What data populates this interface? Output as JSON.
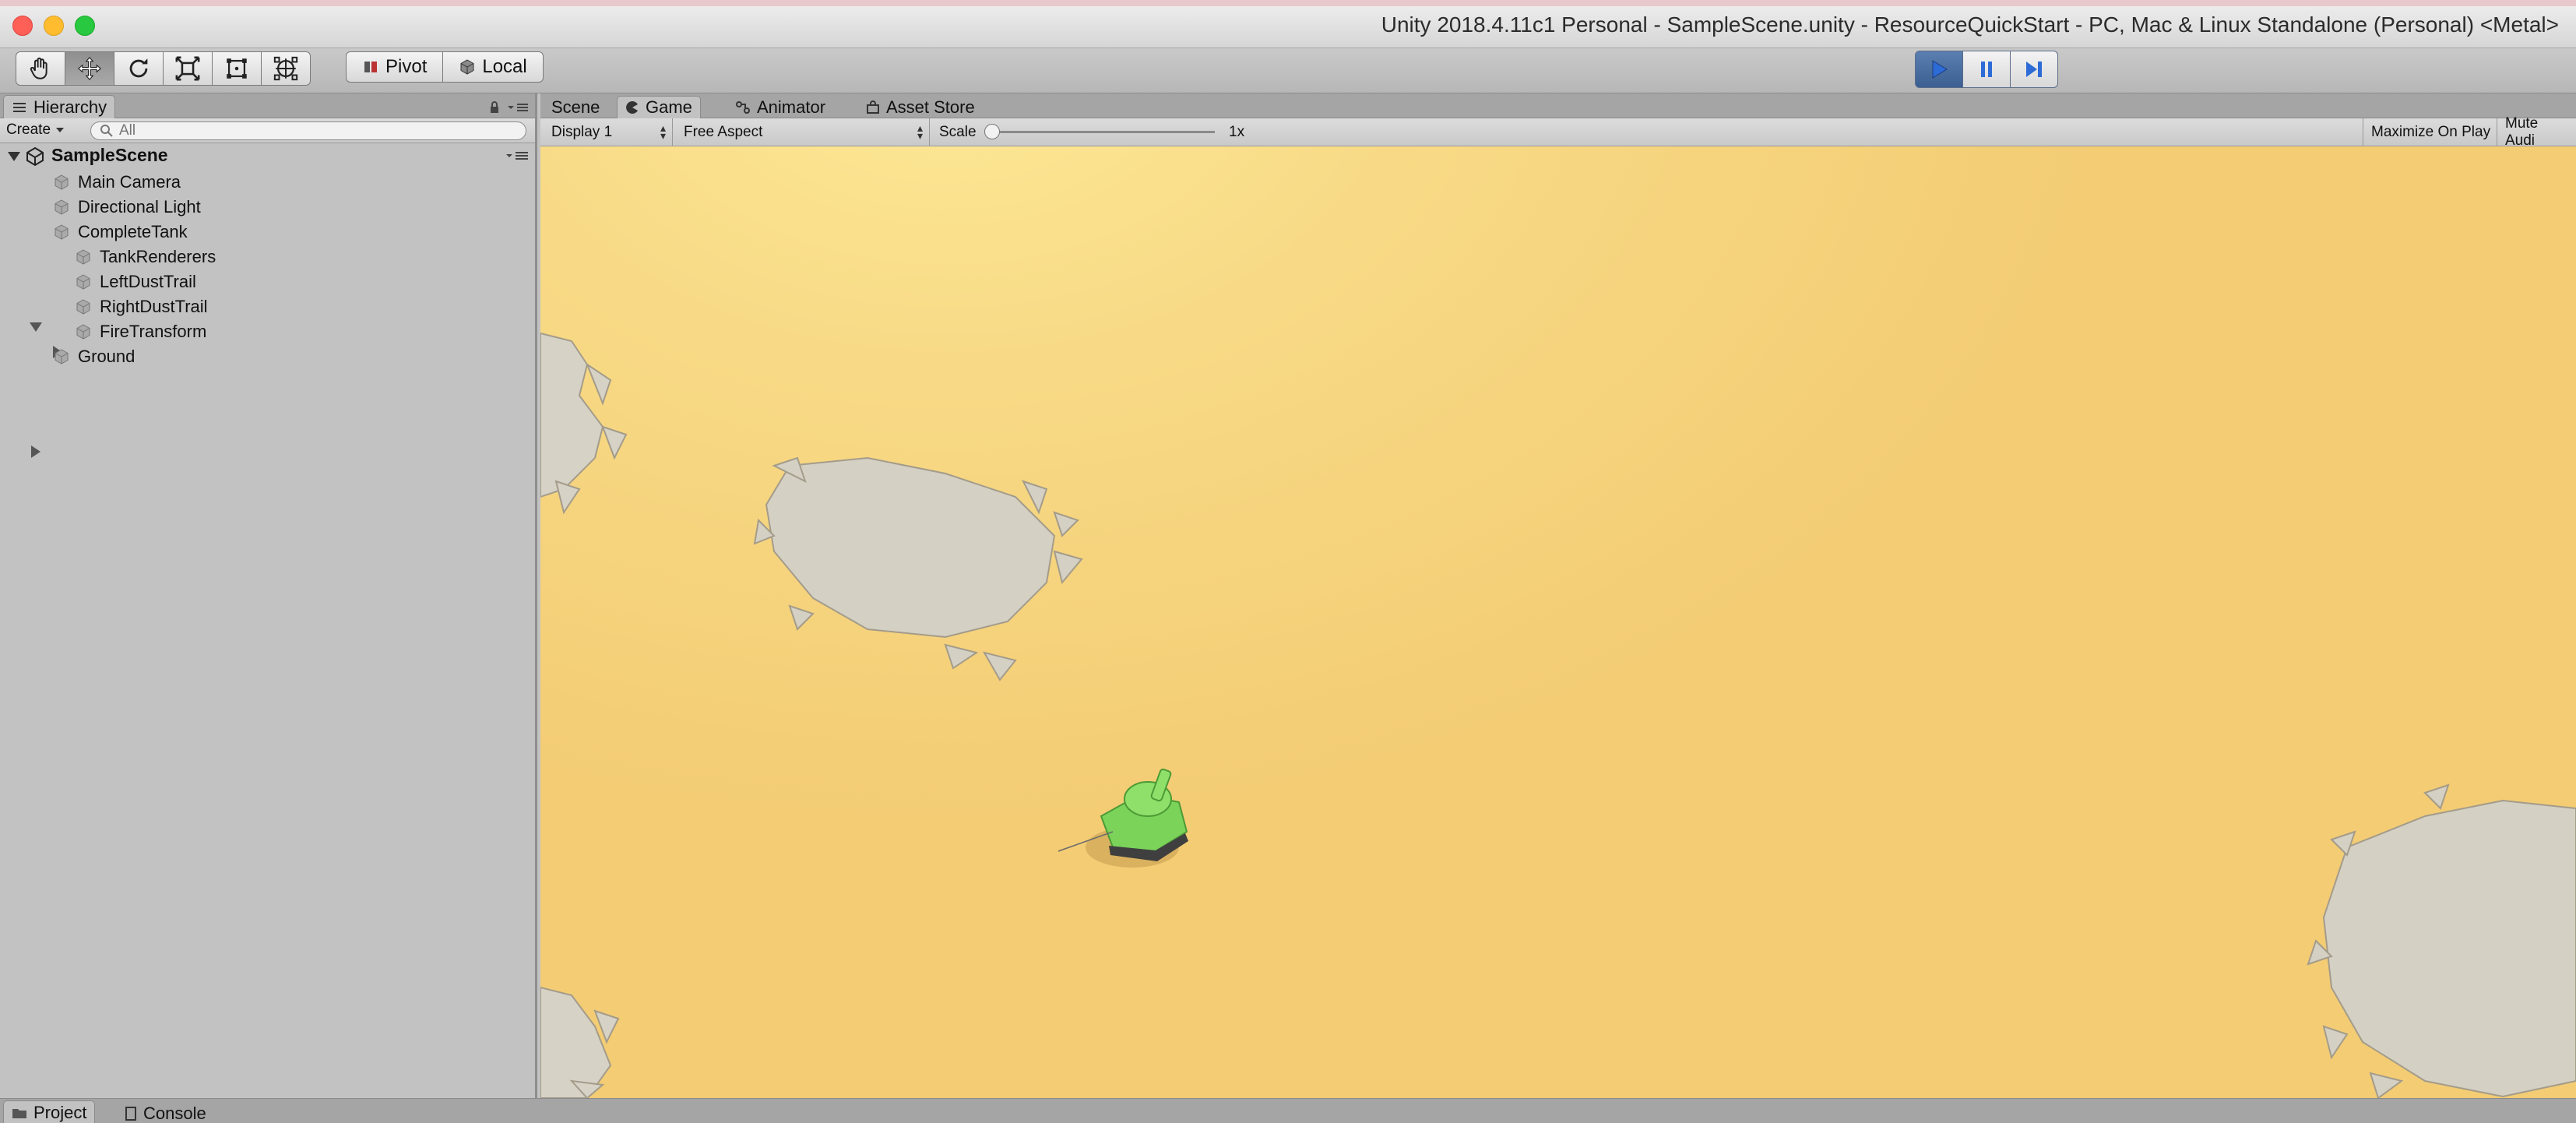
{
  "window": {
    "title": "Unity 2018.4.11c1 Personal - SampleScene.unity - ResourceQuickStart - PC, Mac & Linux Standalone (Personal) <Metal>"
  },
  "toolbar": {
    "tools": [
      "hand-tool",
      "move-tool",
      "rotate-tool",
      "scale-tool",
      "rect-tool",
      "transform-tool"
    ],
    "active_tool": "move-tool",
    "pivot_label": "Pivot",
    "local_label": "Local",
    "play_state": "playing"
  },
  "hierarchy": {
    "tab_label": "Hierarchy",
    "create_label": "Create",
    "search_placeholder": "All",
    "scene_name": "SampleScene",
    "items": [
      {
        "label": "Main Camera"
      },
      {
        "label": "Directional Light"
      },
      {
        "label": "CompleteTank"
      },
      {
        "label": "TankRenderers"
      },
      {
        "label": "LeftDustTrail"
      },
      {
        "label": "RightDustTrail"
      },
      {
        "label": "FireTransform"
      },
      {
        "label": "Ground"
      }
    ]
  },
  "game_view": {
    "tabs": [
      {
        "label": "Scene"
      },
      {
        "label": "Game"
      },
      {
        "label": "Animator"
      },
      {
        "label": "Asset Store"
      }
    ],
    "active_tab": "Game",
    "display": "Display 1",
    "aspect": "Free Aspect",
    "scale_label": "Scale",
    "scale_value": "1x",
    "maximize_label": "Maximize On Play",
    "mute_label": "Mute Audi",
    "ground_color": "#f6d37d",
    "tank_color": "#7bd35a",
    "rubble_color": "#d2cfc4"
  },
  "bottom": {
    "tabs": [
      {
        "label": "Project"
      },
      {
        "label": "Console"
      }
    ]
  },
  "colors": {
    "panel": "#c2c2c2",
    "play_active": "#3f6396",
    "close": "#fe5f57",
    "minimize": "#febc2e",
    "maximize": "#28c840"
  }
}
